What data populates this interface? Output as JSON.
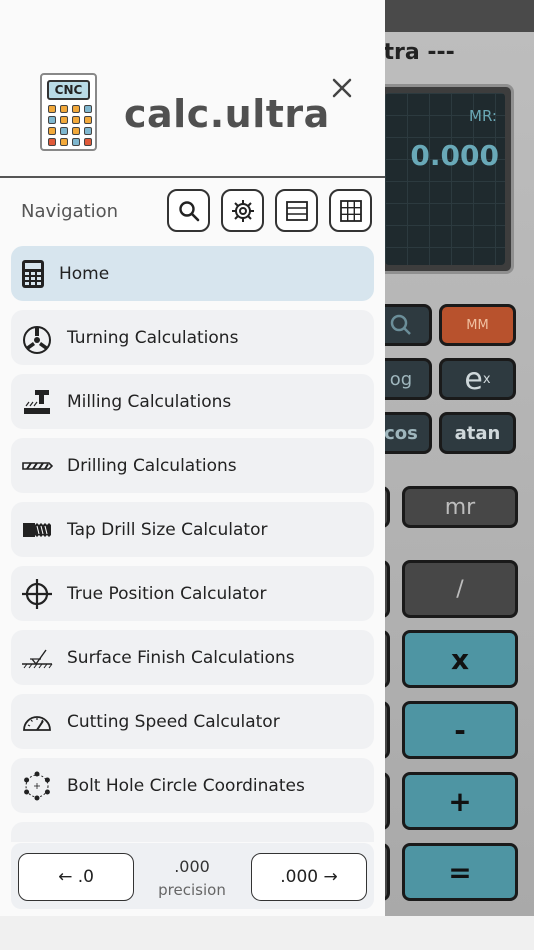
{
  "colors": {
    "drawer_bg": "#fafafa",
    "active_item_bg": "#d7e5ee",
    "item_bg": "#f0f1f3",
    "display_text": "#69a9b8",
    "key_teal": "#4e95a3",
    "key_orange": "#b8522d"
  },
  "header": {
    "logo_text": "CNC",
    "app_name": "calc.ultra",
    "close_icon": "close-icon"
  },
  "toolbar": {
    "label": "Navigation",
    "buttons": [
      {
        "name": "search-icon"
      },
      {
        "name": "gear-icon"
      },
      {
        "name": "list-view-icon"
      },
      {
        "name": "grid-view-icon"
      }
    ]
  },
  "nav": {
    "items": [
      {
        "label": "Home",
        "icon": "calculator-icon",
        "active": true
      },
      {
        "label": "Turning Calculations",
        "icon": "lathe-chuck-icon"
      },
      {
        "label": "Milling Calculations",
        "icon": "mill-icon"
      },
      {
        "label": "Drilling Calculations",
        "icon": "drill-icon"
      },
      {
        "label": "Tap Drill Size Calculator",
        "icon": "tap-icon"
      },
      {
        "label": "True Position Calculator",
        "icon": "crosshair-icon"
      },
      {
        "label": "Surface Finish Calculations",
        "icon": "surface-finish-icon"
      },
      {
        "label": "Cutting Speed Calculator",
        "icon": "speedometer-icon"
      },
      {
        "label": "Bolt Hole Circle Coordinates",
        "icon": "bolt-circle-icon"
      }
    ]
  },
  "footer": {
    "decrease_label": "← .0",
    "precision_value": ".000",
    "precision_label": "precision",
    "increase_label": ".000 →"
  },
  "calculator": {
    "title": "ltra ---",
    "mr_label": "MR:",
    "display_value": "0.000",
    "keys": {
      "mm": "MM",
      "log": "og",
      "exp": "e",
      "exp_sup": "x",
      "cos": "cos",
      "atan": "atan",
      "mr": "mr",
      "divide": "/",
      "multiply": "x",
      "minus": "-",
      "plus": "+",
      "equals": "="
    }
  }
}
